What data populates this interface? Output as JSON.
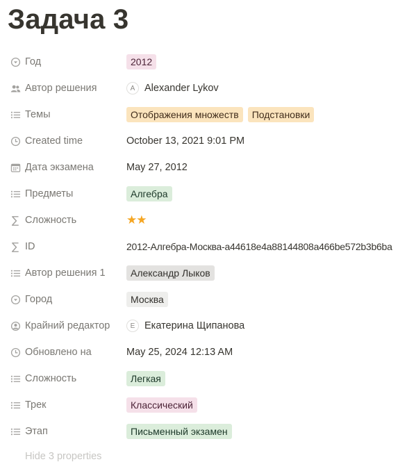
{
  "page": {
    "title": "Задача 3"
  },
  "properties": [
    {
      "name": "Год",
      "icon": "select-icon",
      "value": "2012"
    },
    {
      "name": "Автор решения",
      "icon": "people-icon",
      "avatar": "A",
      "value": "Alexander Lykov"
    },
    {
      "name": "Темы",
      "icon": "list-icon",
      "tags": [
        "Отображения множеств",
        "Подстановки"
      ]
    },
    {
      "name": "Created time",
      "icon": "clock-icon",
      "value": "October 13, 2021 9:01 PM"
    },
    {
      "name": "Дата экзамена",
      "icon": "calendar-icon",
      "value": "May 27, 2012"
    },
    {
      "name": "Предметы",
      "icon": "list-icon",
      "value": "Алгебра"
    },
    {
      "name": "Сложность",
      "icon": "sigma-icon",
      "value": "★★"
    },
    {
      "name": "ID",
      "icon": "sigma-icon",
      "value": "2012-Алгебра-Москва-a44618e4a88144808a466be572b3b6ba"
    },
    {
      "name": "Автор решения 1",
      "icon": "list-icon",
      "value": "Александр Лыков"
    },
    {
      "name": "Город",
      "icon": "select-icon",
      "value": "Москва"
    },
    {
      "name": "Крайний редактор",
      "icon": "person-icon",
      "avatar": "E",
      "value": "Екатерина Щипанова"
    },
    {
      "name": "Обновлено на",
      "icon": "clock-icon",
      "value": "May 25, 2024 12:13 AM"
    },
    {
      "name": "Сложность",
      "icon": "list-icon",
      "value": "Легкая"
    },
    {
      "name": "Трек",
      "icon": "list-icon",
      "value": "Классический"
    },
    {
      "name": "Этап",
      "icon": "list-icon",
      "value": "Письменный экзамен"
    }
  ],
  "footer": {
    "hidden_label": "Hide 3 properties"
  },
  "colors": {
    "star": "#f5a623",
    "tag_pink": "#f5e0e9",
    "tag_yellow": "#fbe4bd",
    "tag_green": "#dbeddb",
    "tag_gray": "#e3e2e0"
  }
}
